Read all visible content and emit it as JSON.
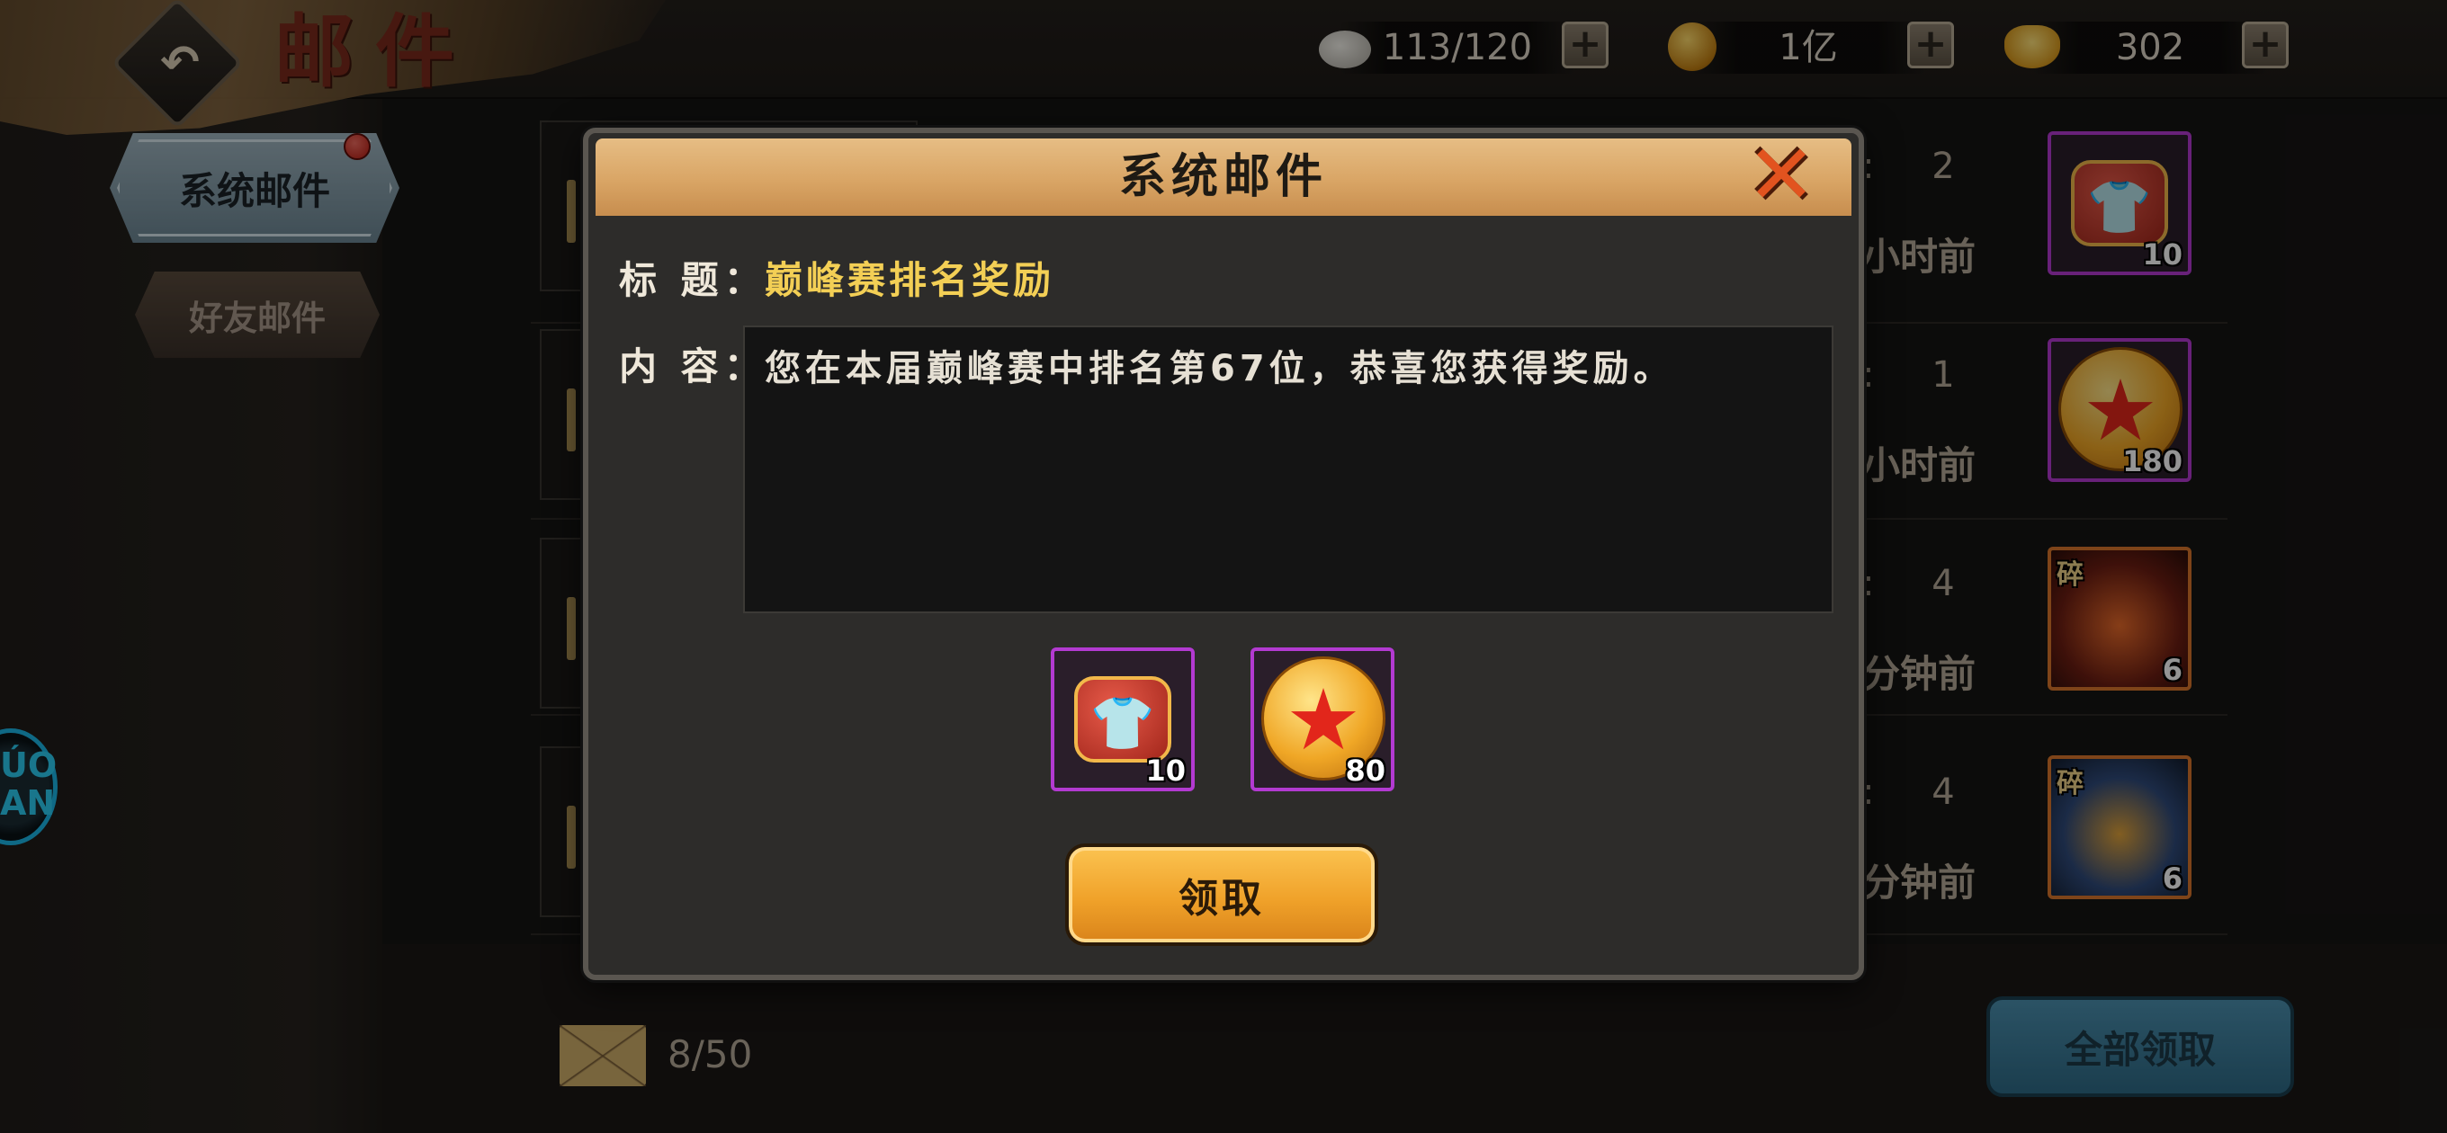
{
  "header": {
    "title": "邮件",
    "back_icon": "back-arrow-icon"
  },
  "resources": {
    "stamina": {
      "value": "113/120",
      "icon": "stamina-icon"
    },
    "coin": {
      "value": "1亿",
      "icon": "gold-coin-icon"
    },
    "ingot": {
      "value": "302",
      "icon": "gold-ingot-icon"
    },
    "plus_label": "+"
  },
  "sidebar": {
    "tabs": [
      {
        "label": "系统邮件",
        "selected": true,
        "has_notification": true
      },
      {
        "label": "好友邮件",
        "selected": false
      }
    ],
    "floating_icon_text": "ÚO\nAN"
  },
  "mail_list": {
    "rows": [
      {
        "time_num": "2",
        "time_unit": "小时前",
        "reward_icon": "costume-fragment-icon",
        "reward_count": "10"
      },
      {
        "time_num": "1",
        "time_unit": "小时前",
        "reward_icon": "star-coin-icon",
        "reward_count": "180"
      },
      {
        "time_num": "4",
        "time_unit": "分钟前",
        "reward_icon": "hero-fragment-icon",
        "reward_count": "6",
        "tag": "碎"
      },
      {
        "time_num": "4",
        "time_unit": "分钟前",
        "reward_icon": "hero-fragment-icon",
        "reward_count": "6",
        "tag": "碎"
      }
    ],
    "colon": ":"
  },
  "footer": {
    "mail_count": "8/50",
    "claim_all_label": "全部领取"
  },
  "modal": {
    "title": "系统邮件",
    "subject_label": "标 题：",
    "subject_value": "巅峰赛排名奖励",
    "content_label": "内 容：",
    "content_value": "您在本届巅峰赛中排名第67位，恭喜您获得奖励。",
    "rewards": [
      {
        "icon": "costume-fragment-icon",
        "count": "10"
      },
      {
        "icon": "star-coin-icon",
        "count": "80"
      }
    ],
    "receive_label": "领取",
    "close_icon": "close-x-icon",
    "close_glyph": "✕"
  },
  "colors": {
    "accent_gold": "#f3cf55",
    "button_orange": "#f0a22a",
    "tab_glow": "#1aa7d8",
    "rarity_purple": "#b33ad1",
    "rarity_orange": "#d9762c"
  }
}
